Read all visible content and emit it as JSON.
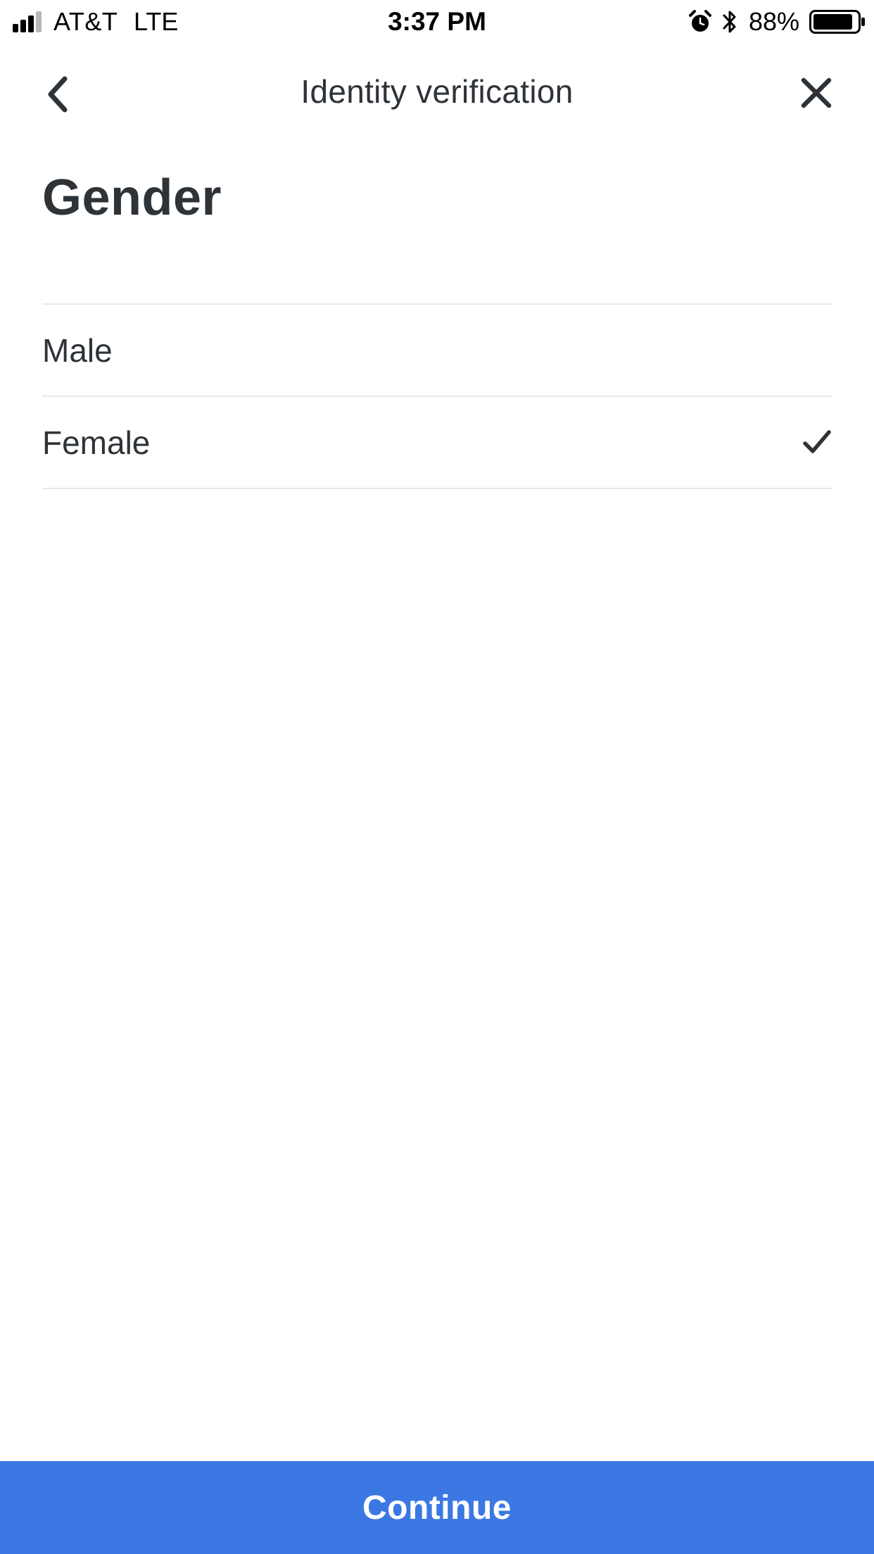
{
  "status_bar": {
    "carrier": "AT&T",
    "network": "LTE",
    "time": "3:37 PM",
    "battery_percent": "88%",
    "signal_bars": 3,
    "battery_level": 0.88,
    "icons": [
      "signal-icon",
      "alarm-icon",
      "bluetooth-icon",
      "battery-icon"
    ]
  },
  "nav": {
    "title": "Identity verification",
    "back_icon": "chevron-left-icon",
    "close_icon": "close-icon"
  },
  "page": {
    "title": "Gender"
  },
  "options": [
    {
      "label": "Male",
      "selected": false
    },
    {
      "label": "Female",
      "selected": true
    }
  ],
  "footer": {
    "continue_label": "Continue"
  },
  "colors": {
    "text": "#2e3338",
    "divider": "#e8e8e8",
    "accent": "#3c78e3",
    "button_text": "#ffffff"
  }
}
